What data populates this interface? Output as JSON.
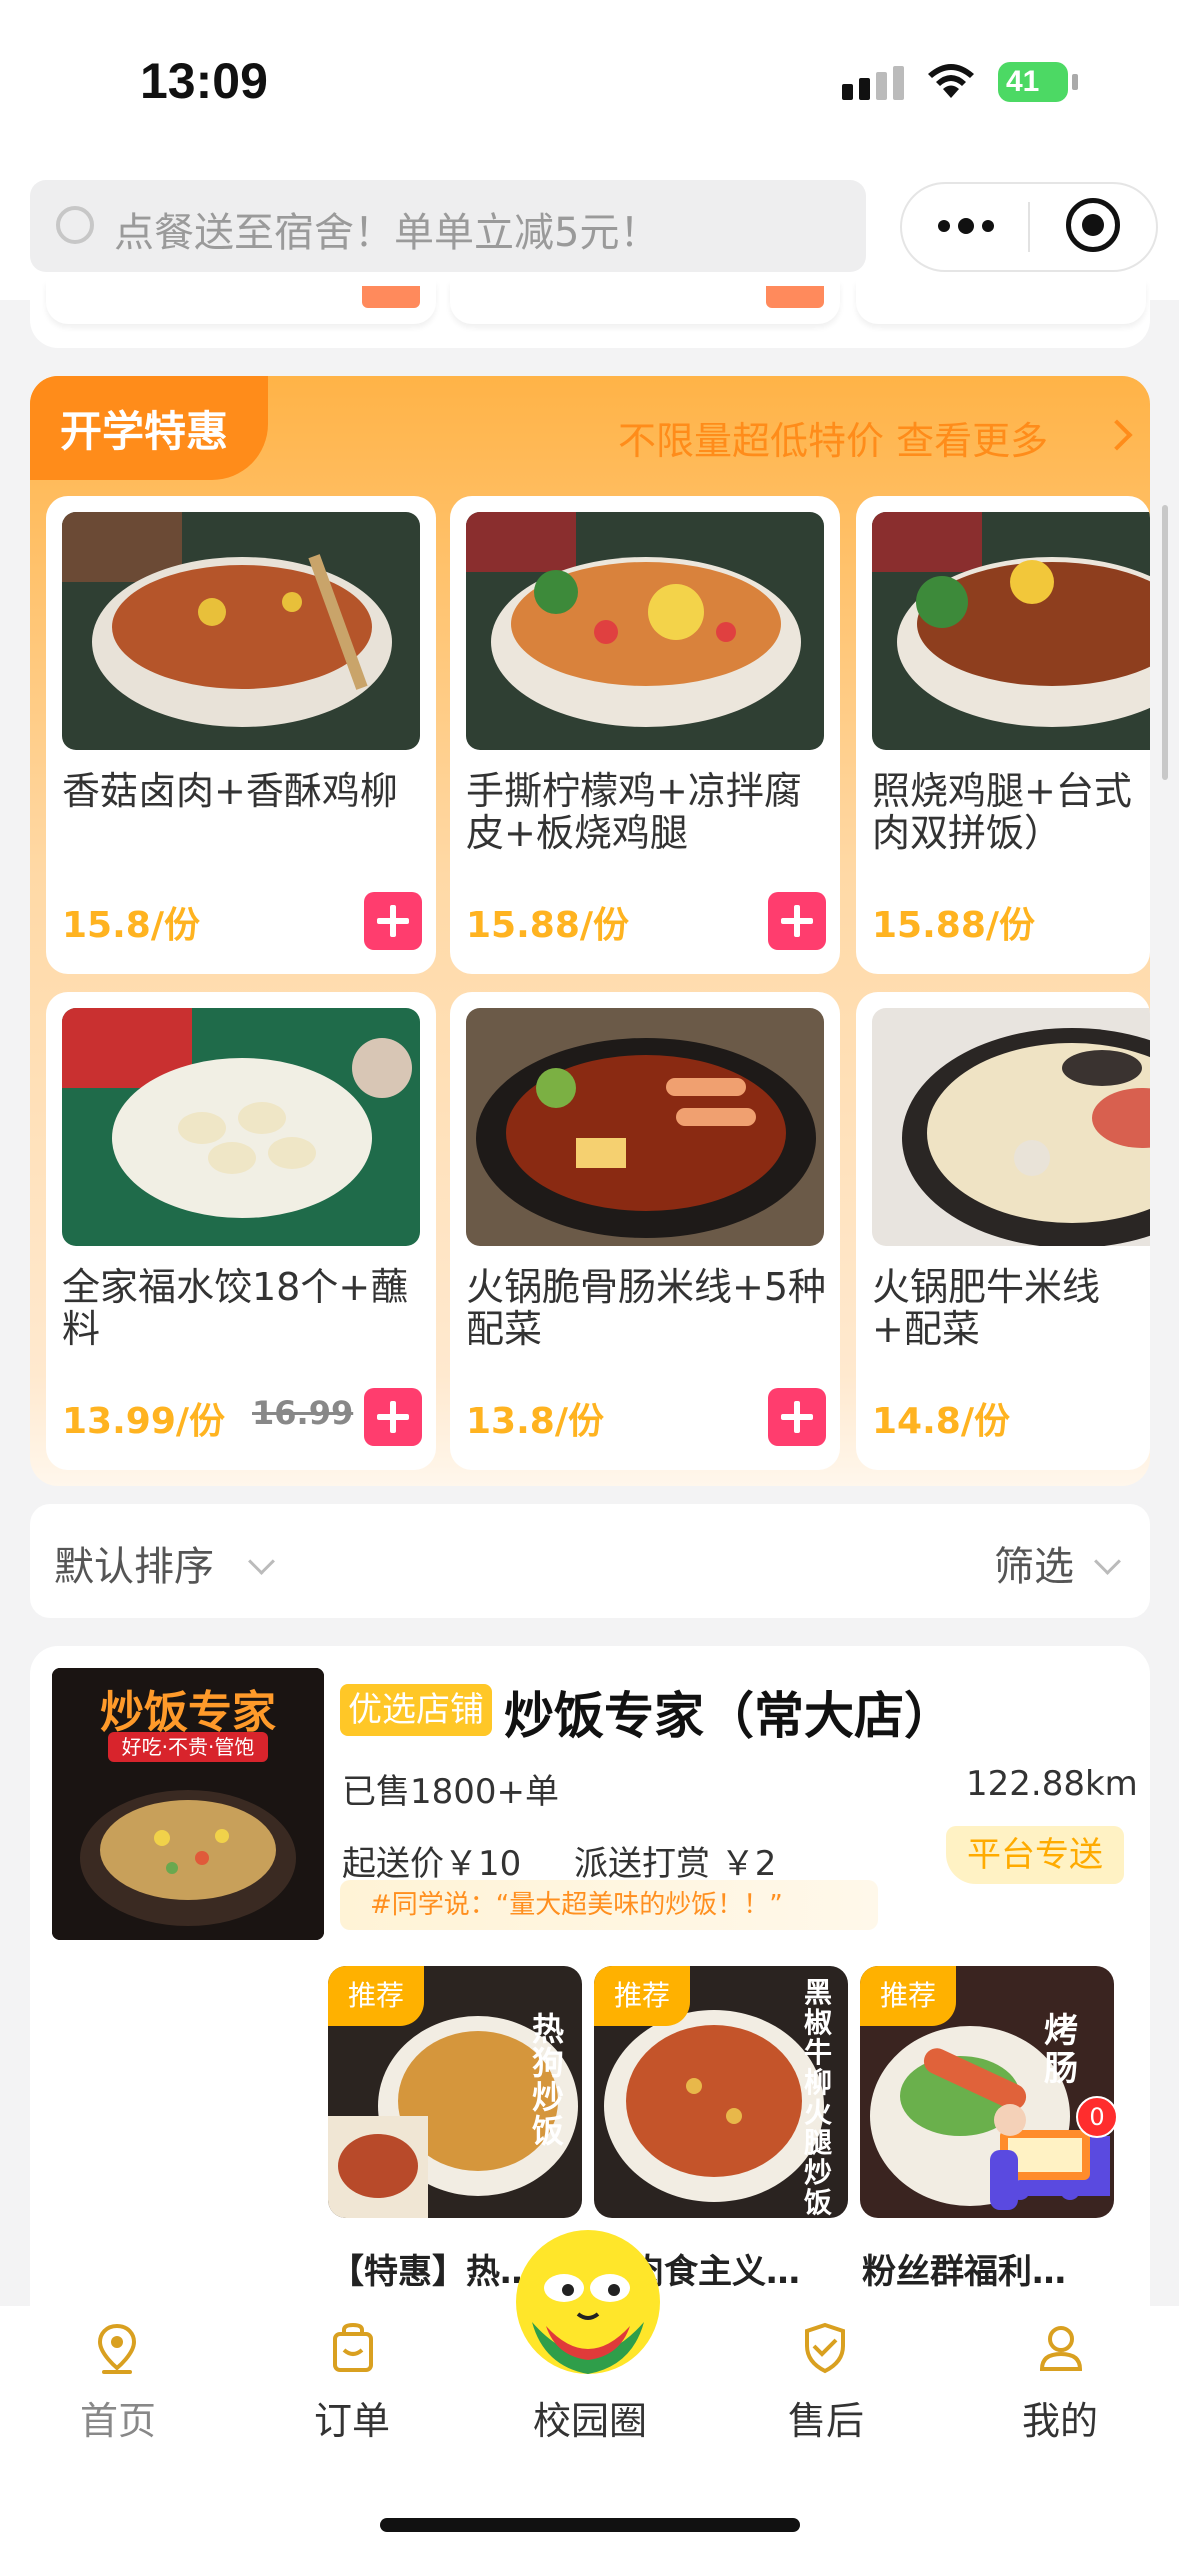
{
  "status_bar": {
    "time": "13:09",
    "battery": "41"
  },
  "search": {
    "placeholder": "点餐送至宿舍！单单立减5元！"
  },
  "promo": {
    "title": "开学特惠",
    "more": "不限量超低特价 查看更多",
    "items": [
      {
        "name": "香菇卤肉+香酥鸡柳",
        "price": "15.8/份",
        "old_price": ""
      },
      {
        "name": "手撕柠檬鸡+凉拌腐皮+板烧鸡腿",
        "price": "15.88/份",
        "old_price": ""
      },
      {
        "name": "照烧鸡腿+台式肉双拼饭）",
        "price": "15.88/份",
        "old_price": ""
      },
      {
        "name": "全家福水饺18个+蘸料",
        "price": "13.99/份",
        "old_price": "16.99"
      },
      {
        "name": "火锅脆骨肠米线+5种配菜",
        "price": "13.8/份",
        "old_price": ""
      },
      {
        "name": "火锅肥牛米线+配菜",
        "price": "14.8/份",
        "old_price": ""
      }
    ]
  },
  "sort": {
    "default": "默认排序",
    "filter": "筛选"
  },
  "shop": {
    "badge": "优选店铺",
    "name": "炒饭专家（常大店）",
    "sold": "已售1800+单",
    "distance": "122.88km",
    "min_order": "起送价￥10",
    "delivery_tip": "派送打赏 ￥2",
    "delivery_tag": "平台专送",
    "quote": "#同学说：“量大超美味的炒饭！！”",
    "logo_title": "炒饭专家",
    "logo_sub": "好吃·不贵·管饱",
    "dishes": [
      {
        "tag": "推荐",
        "name": "【特惠】热…",
        "overlay": "热狗炒饭"
      },
      {
        "tag": "推荐",
        "name": "肉食主义…",
        "overlay": "黑椒牛柳火腿炒饭"
      },
      {
        "tag": "推荐",
        "name": "粉丝群福利…",
        "overlay": "烤肠"
      }
    ]
  },
  "cart_badge": "0",
  "tabs": [
    {
      "label": "首页",
      "icon": "location-pin-icon"
    },
    {
      "label": "订单",
      "icon": "order-bag-icon"
    },
    {
      "label": "校园圈",
      "icon": "mascot-icon"
    },
    {
      "label": "售后",
      "icon": "shield-check-icon"
    },
    {
      "label": "我的",
      "icon": "user-icon"
    }
  ]
}
